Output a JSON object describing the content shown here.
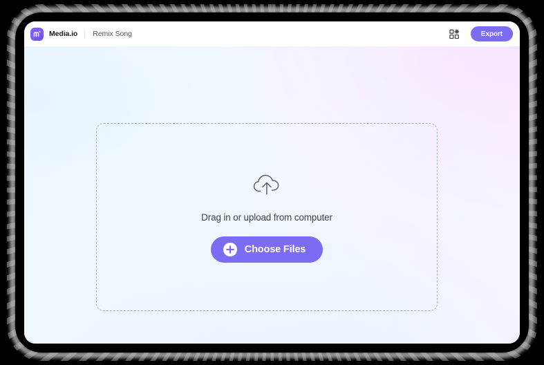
{
  "window": {
    "header": {
      "logo_icon": "media-io-logo-icon",
      "brand_name": "Media.io",
      "project_name": "Remix Song",
      "apps_grid_icon": "apps-grid-icon",
      "export_label": "Export"
    },
    "canvas": {
      "dropzone": {
        "upload_icon": "cloud-upload-icon",
        "hint_text": "Drag in or upload from computer",
        "choose_files_label": "Choose Files",
        "plus_icon": "plus-circle-icon"
      }
    }
  },
  "colors": {
    "accent_purple": "#7c6cf4",
    "logo_purple": "#8b5cf6",
    "dashed_border": "#a8abd4",
    "brand_text": "#16181d",
    "project_text": "#4b5059",
    "hint_text": "#3d424d",
    "canvas_gradient_left": "#eef7fc",
    "canvas_gradient_right": "#fbf1fd",
    "frame_black": "#000000"
  }
}
